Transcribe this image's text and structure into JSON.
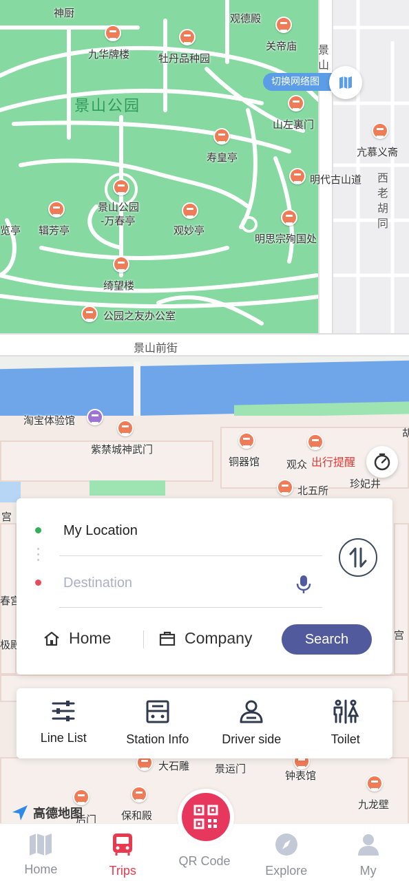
{
  "map": {
    "park_name": "景山公园",
    "labels": {
      "shenchu": "神厨",
      "guandedian": "观德殿",
      "guandimiao": "关帝庙",
      "jiucuipailou": "九华牌楼",
      "mudanpinzhongyuan": "牡丹品种园",
      "shanzuolimen": "山左裏门",
      "liumuyitong": "亢慕义斋",
      "shouhuangting": "寿皇亭",
      "mingdaigushandao": "明代古山道",
      "jifangting": "辑芳亭",
      "wanchunting_1": "景山公园",
      "wanchunting_2": "-万春亭",
      "guanmiaoting": "观妙亭",
      "mingsizong": "明思宗殉国处",
      "lanting": "览亭",
      "qiwanglou": "绮望楼",
      "gongyuanzhiyou": "公园之友办公室",
      "taobao": "淘宝体验馆",
      "shenwumen": "紫禁城神武门",
      "tongqiguan": "铜器馆",
      "guanzhong": "观众",
      "zhenfeijing": "珍妃井",
      "beiwusuo": "北五所",
      "gong_left": "宫",
      "chun": "春宫",
      "ji": "极殿",
      "gong_right": "宫",
      "dashidiao": "大石雕",
      "jingyunmen": "景运门",
      "zhongbiaoguan": "钟表馆",
      "baohedian": "保和殿",
      "jiulongbi": "九龙壁",
      "huoqi": "后门",
      "hu": "胡"
    },
    "streets": {
      "jingshan_qianjie": "景山前街",
      "jingshan_jie": "景山街",
      "xilao_hutong": "西老胡同"
    },
    "switch_label": "切换网络图",
    "trip_alert": "出行提醒",
    "logo_text": "高德地图"
  },
  "search": {
    "origin_value": "My Location",
    "destination_placeholder": "Destination",
    "home_label": "Home",
    "company_label": "Company",
    "search_button": "Search"
  },
  "services": [
    {
      "label": "Line List",
      "icon": "line-list-icon"
    },
    {
      "label": "Station Info",
      "icon": "station-info-icon"
    },
    {
      "label": "Driver side",
      "icon": "driver-icon"
    },
    {
      "label": "Toilet",
      "icon": "toilet-icon"
    }
  ],
  "nav": {
    "home": "Home",
    "trips": "Trips",
    "qr": "QR Code",
    "explore": "Explore",
    "my": "My",
    "active": "Trips"
  },
  "colors": {
    "accent": "#505a9c",
    "active_tab": "#e73a4e",
    "qr_button": "#e8375c",
    "park": "#86d9a1",
    "river": "#6fa6ea",
    "poi": "#ef7b57"
  }
}
